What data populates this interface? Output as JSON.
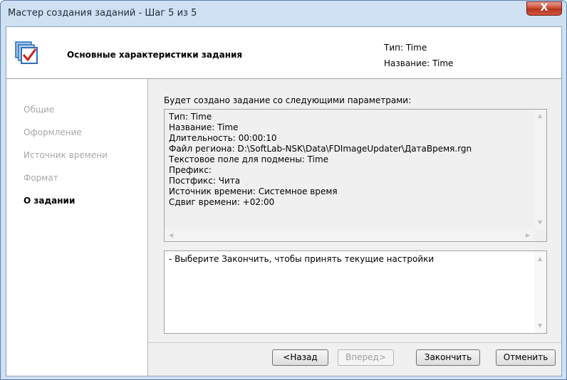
{
  "window": {
    "title": "Мастер создания заданий - Шаг 5 из 5",
    "close_label": "X"
  },
  "header": {
    "icon": "checklist-icon",
    "title": "Основные характеристики задания",
    "type_line": "Тип: Time",
    "name_line": "Название: Time"
  },
  "steps": [
    {
      "label": "Общие",
      "active": false
    },
    {
      "label": "Оформление",
      "active": false
    },
    {
      "label": "Источник времени",
      "active": false
    },
    {
      "label": "Формат",
      "active": false
    },
    {
      "label": "О задании",
      "active": true
    }
  ],
  "summary": {
    "label": "Будет создано задание со следующими параметрами:",
    "lines": [
      "Тип: Time",
      "Название: Time",
      "Длительность: 00:00:10",
      "Файл региона: D:\\SoftLab-NSK\\Data\\FDImageUpdater\\ДатаВремя.rgn",
      "Текстовое поле для подмены: Time",
      "Префикс:",
      "Постфикс:  Чита",
      "Источник времени: Системное время",
      "Сдвиг времени: +02:00"
    ]
  },
  "hint": {
    "text": "- Выберите Закончить, чтобы принять текущие настройки"
  },
  "buttons": {
    "back": "<Назад",
    "next": "Вперед>",
    "finish": "Закончить",
    "cancel": "Отменить"
  },
  "colors": {
    "close_button": "#c8452f",
    "icon_blue": "#2f6fb7",
    "check_red": "#cc2020"
  }
}
